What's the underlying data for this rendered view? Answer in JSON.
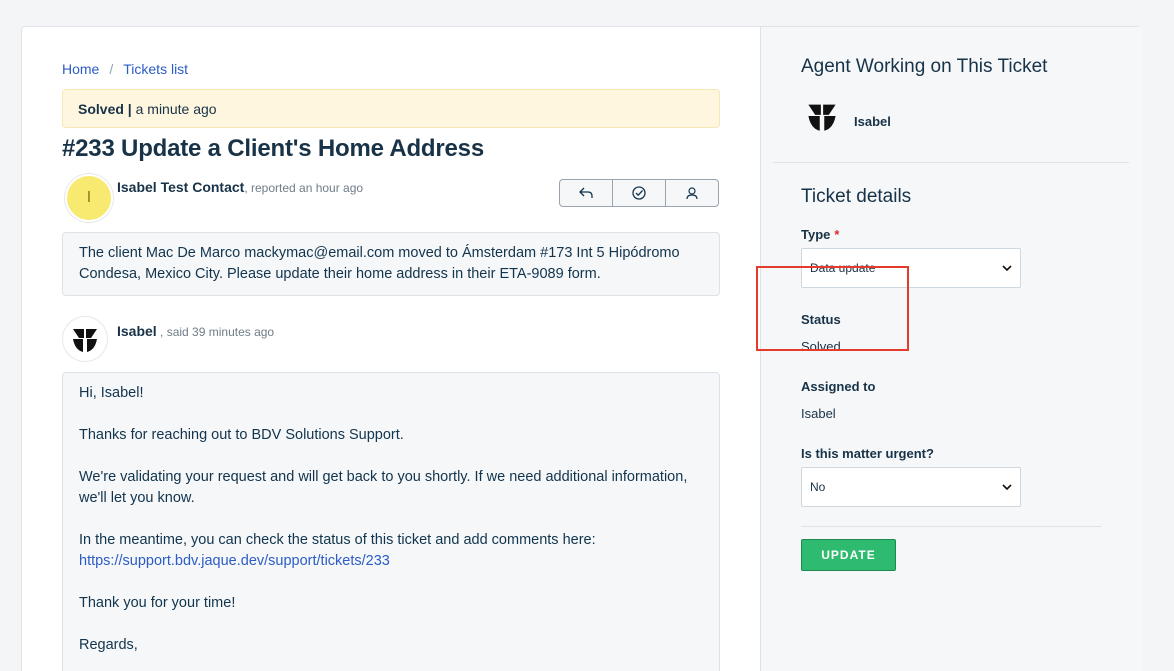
{
  "breadcrumb": {
    "home": "Home",
    "separator": "/",
    "tickets": "Tickets list"
  },
  "banner": {
    "status": "Solved",
    "separator": "|",
    "time": "a minute ago"
  },
  "ticket": {
    "title": "#233 Update a Client's Home Address",
    "reporter_initial": "I",
    "reporter_name": "Isabel Test Contact",
    "reported_text": ", reported an hour ago",
    "description": "The client Mac De Marco mackymac@email.com moved to Ámsterdam #173 Int 5 Hipódromo Condesa, Mexico City. Please update their home address in their ETA-9089 form."
  },
  "actions": {
    "reply_icon": "reply-icon",
    "resolve_icon": "check-circle-icon",
    "assign_icon": "user-icon"
  },
  "reply": {
    "author": "Isabel",
    "said_text": " , said 39 minutes ago",
    "greeting": "Hi, Isabel!",
    "p1": "Thanks for reaching out to BDV Solutions Support.",
    "p2": "We're validating your request and will get back to you shortly. If we need additional information, we'll let you know.",
    "p3": "In the meantime, you can check the status of this ticket and add comments here:",
    "link": "https://support.bdv.jaque.dev/support/tickets/233",
    "p4": "Thank you for your time!",
    "closing": "Regards,"
  },
  "sidebar": {
    "agent_heading": "Agent Working on This Ticket",
    "agent_name": "Isabel",
    "details_heading": "Ticket details",
    "type_label": "Type",
    "required_mark": "*",
    "type_value": "Data update",
    "status_label": "Status",
    "status_value": "Solved",
    "assigned_label": "Assigned to",
    "assigned_value": "Isabel",
    "urgent_label": "Is this matter urgent?",
    "urgent_value": "No",
    "update_button": "UPDATE"
  },
  "colors": {
    "accent": "#2c5cc5",
    "update": "#2ebb6f",
    "highlight": "#e53b2d",
    "banner": "#fef6df"
  }
}
